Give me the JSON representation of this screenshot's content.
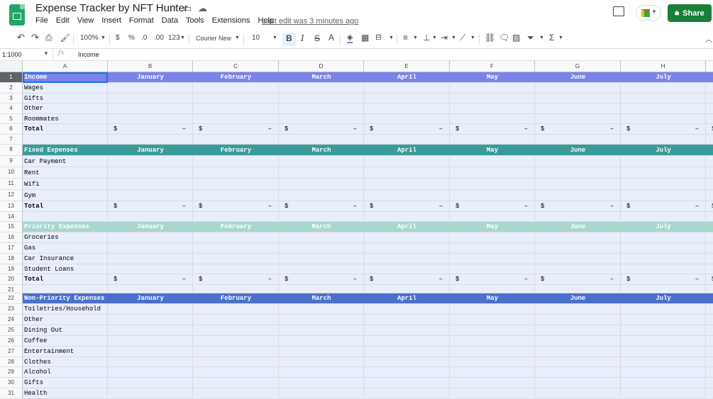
{
  "doc": {
    "title": "Expense Tracker by NFT Hunter",
    "menu": [
      "File",
      "Edit",
      "View",
      "Insert",
      "Format",
      "Data",
      "Tools",
      "Extensions",
      "Help"
    ],
    "last_edit": "Last edit was 3 minutes ago",
    "share_label": "Share"
  },
  "toolbar": {
    "zoom": "100%",
    "currency": "$",
    "percent": "%",
    "dec_decrease": ".0",
    "dec_increase": ".00",
    "number_format": "123",
    "font": "Courier New",
    "font_size": "10",
    "bold": "B",
    "italic": "I",
    "strike": "S",
    "text_color": "A",
    "function": "Σ"
  },
  "formula_bar": {
    "name_box": "1:1000",
    "fx": "fx",
    "value": "Income"
  },
  "columns": [
    "A",
    "B",
    "C",
    "D",
    "E",
    "F",
    "G",
    "H"
  ],
  "colors": {
    "income_header": "#7b83eb",
    "fixed_header": "#3b9b9a",
    "priority_header": "#a9d6cf",
    "nonpriority_header": "#4a6fcf",
    "row_bg": "#e9eefc"
  },
  "rows": [
    {
      "n": "1",
      "type": "header",
      "style": "income",
      "label": "Income",
      "months": [
        "January",
        "February",
        "March",
        "April",
        "May",
        "June",
        "July"
      ]
    },
    {
      "n": "2",
      "type": "item",
      "label": "Wages"
    },
    {
      "n": "3",
      "type": "item",
      "label": "Gifts"
    },
    {
      "n": "4",
      "type": "item",
      "label": "Other"
    },
    {
      "n": "5",
      "type": "item",
      "label": "Roommates"
    },
    {
      "n": "6",
      "type": "total",
      "label": "Total",
      "cur": "$",
      "val": "–"
    },
    {
      "n": "7",
      "type": "blank"
    },
    {
      "n": "8",
      "type": "header",
      "style": "fixed",
      "label": "Fixed Expenses",
      "months": [
        "January",
        "February",
        "March",
        "April",
        "May",
        "June",
        "July"
      ]
    },
    {
      "n": "9",
      "type": "item",
      "label": "Car Payment"
    },
    {
      "n": "10",
      "type": "item",
      "label": "Rent"
    },
    {
      "n": "11",
      "type": "item",
      "label": "Wifi"
    },
    {
      "n": "12",
      "type": "item",
      "label": "Gym"
    },
    {
      "n": "13",
      "type": "total",
      "label": "Total",
      "cur": "$",
      "val": "–"
    },
    {
      "n": "14",
      "type": "blank"
    },
    {
      "n": "15",
      "type": "header",
      "style": "priority",
      "label": "Priority Expenses",
      "months": [
        "January",
        "February",
        "March",
        "April",
        "May",
        "June",
        "July"
      ]
    },
    {
      "n": "16",
      "type": "item",
      "label": "Groceries"
    },
    {
      "n": "17",
      "type": "item",
      "label": "Gas"
    },
    {
      "n": "18",
      "type": "item",
      "label": "Car Insurance"
    },
    {
      "n": "19",
      "type": "item",
      "label": "Student Loans"
    },
    {
      "n": "20",
      "type": "total",
      "label": "Total",
      "cur": "$",
      "val": "–"
    },
    {
      "n": "21",
      "type": "blank"
    },
    {
      "n": "22",
      "type": "header",
      "style": "nonpriority",
      "label": "Non-Priority Expenses",
      "months": [
        "January",
        "February",
        "March",
        "April",
        "May",
        "June",
        "July"
      ]
    },
    {
      "n": "23",
      "type": "item",
      "label": "Toiletries/Household"
    },
    {
      "n": "24",
      "type": "item",
      "label": "Other"
    },
    {
      "n": "25",
      "type": "item",
      "label": "Dining Out"
    },
    {
      "n": "26",
      "type": "item",
      "label": "Coffee"
    },
    {
      "n": "27",
      "type": "item",
      "label": "Entertainment"
    },
    {
      "n": "28",
      "type": "item",
      "label": "Clothes"
    },
    {
      "n": "29",
      "type": "item",
      "label": "Alcohol"
    },
    {
      "n": "30",
      "type": "item",
      "label": "Gifts"
    },
    {
      "n": "31",
      "type": "item",
      "label": "Health"
    }
  ]
}
